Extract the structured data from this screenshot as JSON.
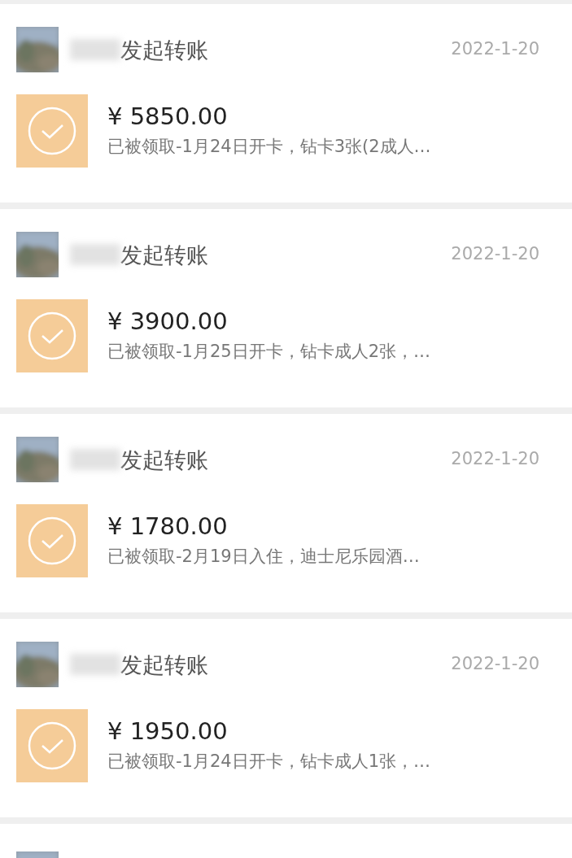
{
  "transfers": [
    {
      "title": "发起转账",
      "date": "2022-1-20",
      "amount": "¥ 5850.00",
      "note": "已被领取-1月24日开卡，钻卡3张(2成人…"
    },
    {
      "title": "发起转账",
      "date": "2022-1-20",
      "amount": "¥ 3900.00",
      "note": "已被领取-1月25日开卡，钻卡成人2张，…"
    },
    {
      "title": "发起转账",
      "date": "2022-1-20",
      "amount": "¥ 1780.00",
      "note": "已被领取-2月19日入住，迪士尼乐园酒…"
    },
    {
      "title": "发起转账",
      "date": "2022-1-20",
      "amount": "¥ 1950.00",
      "note": "已被领取-1月24日开卡，钻卡成人1张，…"
    }
  ],
  "more_below": true
}
